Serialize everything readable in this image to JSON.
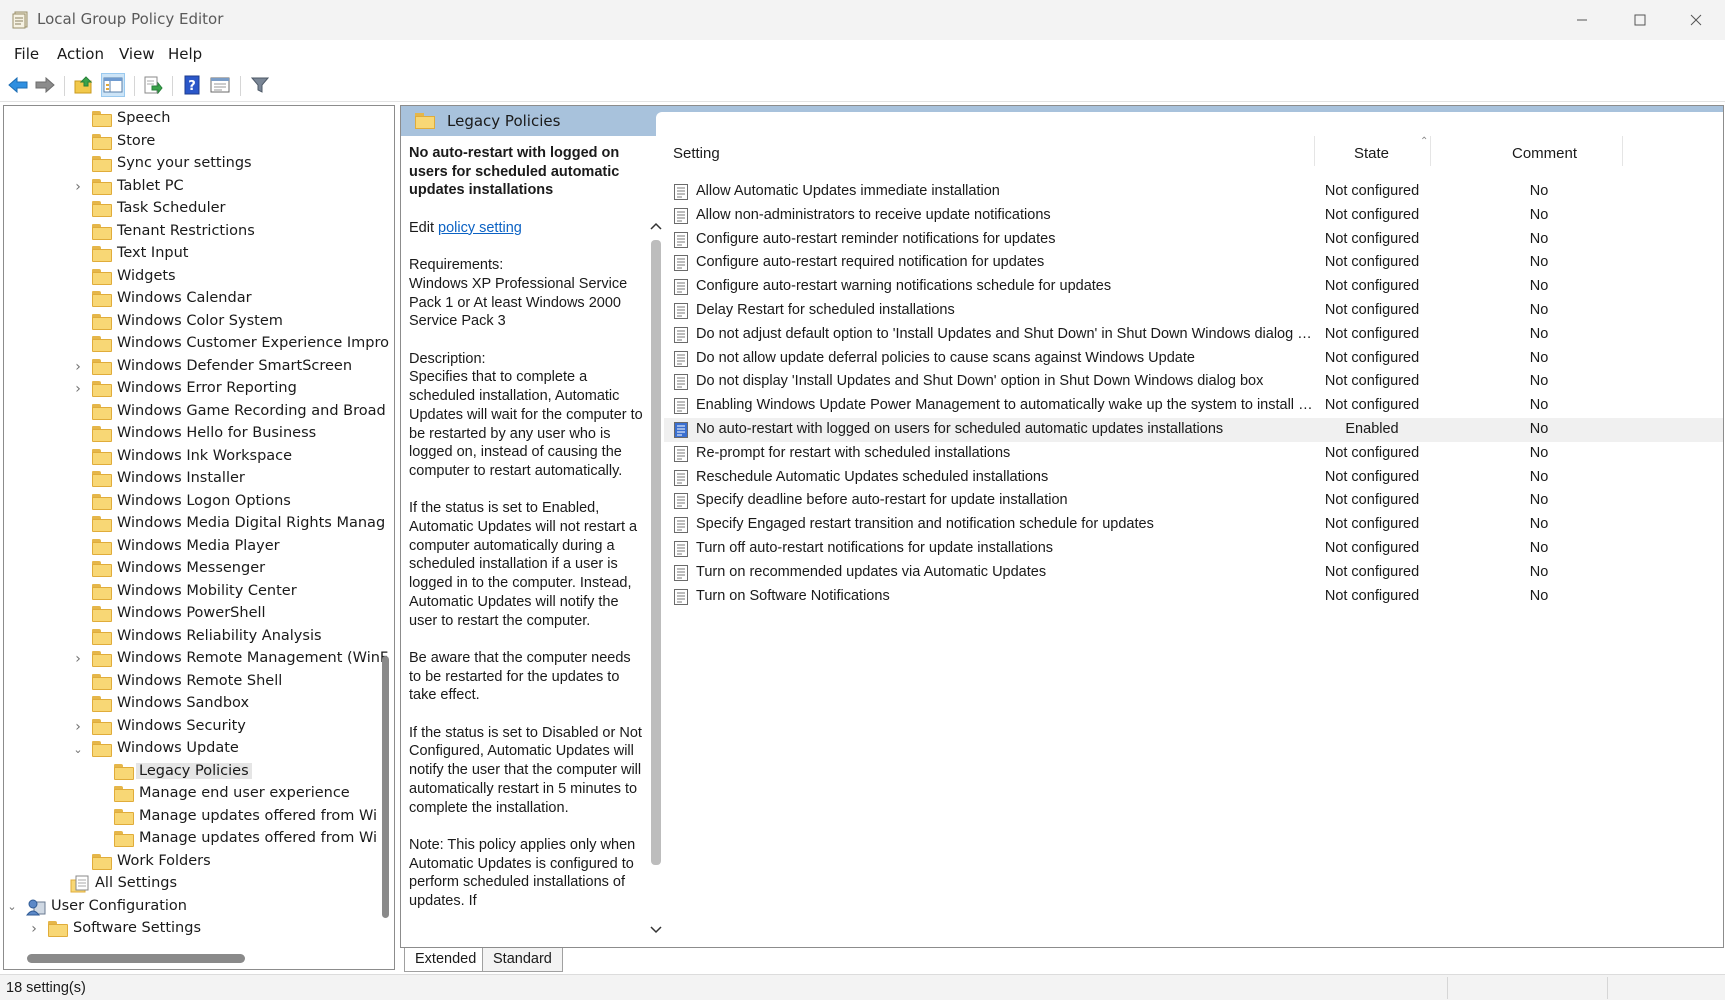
{
  "window": {
    "title": "Local Group Policy Editor"
  },
  "menu": [
    "File",
    "Action",
    "View",
    "Help"
  ],
  "toolbar": [
    "back-icon",
    "forward-icon",
    "up-folder-icon",
    "show-hide-tree-icon",
    "export-list-icon",
    "help-icon",
    "properties-icon",
    "filter-icon"
  ],
  "tree": [
    {
      "label": "Speech",
      "depth": 4,
      "exp": "none",
      "icon": "folder"
    },
    {
      "label": "Store",
      "depth": 4,
      "exp": "none",
      "icon": "folder"
    },
    {
      "label": "Sync your settings",
      "depth": 4,
      "exp": "none",
      "icon": "folder"
    },
    {
      "label": "Tablet PC",
      "depth": 4,
      "exp": "collapsed",
      "icon": "folder"
    },
    {
      "label": "Task Scheduler",
      "depth": 4,
      "exp": "none",
      "icon": "folder"
    },
    {
      "label": "Tenant Restrictions",
      "depth": 4,
      "exp": "none",
      "icon": "folder"
    },
    {
      "label": "Text Input",
      "depth": 4,
      "exp": "none",
      "icon": "folder"
    },
    {
      "label": "Widgets",
      "depth": 4,
      "exp": "none",
      "icon": "folder"
    },
    {
      "label": "Windows Calendar",
      "depth": 4,
      "exp": "none",
      "icon": "folder"
    },
    {
      "label": "Windows Color System",
      "depth": 4,
      "exp": "none",
      "icon": "folder"
    },
    {
      "label": "Windows Customer Experience Impro",
      "depth": 4,
      "exp": "none",
      "icon": "folder"
    },
    {
      "label": "Windows Defender SmartScreen",
      "depth": 4,
      "exp": "collapsed",
      "icon": "folder"
    },
    {
      "label": "Windows Error Reporting",
      "depth": 4,
      "exp": "collapsed",
      "icon": "folder"
    },
    {
      "label": "Windows Game Recording and Broad",
      "depth": 4,
      "exp": "none",
      "icon": "folder"
    },
    {
      "label": "Windows Hello for Business",
      "depth": 4,
      "exp": "none",
      "icon": "folder"
    },
    {
      "label": "Windows Ink Workspace",
      "depth": 4,
      "exp": "none",
      "icon": "folder"
    },
    {
      "label": "Windows Installer",
      "depth": 4,
      "exp": "none",
      "icon": "folder"
    },
    {
      "label": "Windows Logon Options",
      "depth": 4,
      "exp": "none",
      "icon": "folder"
    },
    {
      "label": "Windows Media Digital Rights Manag",
      "depth": 4,
      "exp": "none",
      "icon": "folder"
    },
    {
      "label": "Windows Media Player",
      "depth": 4,
      "exp": "none",
      "icon": "folder"
    },
    {
      "label": "Windows Messenger",
      "depth": 4,
      "exp": "none",
      "icon": "folder"
    },
    {
      "label": "Windows Mobility Center",
      "depth": 4,
      "exp": "none",
      "icon": "folder"
    },
    {
      "label": "Windows PowerShell",
      "depth": 4,
      "exp": "none",
      "icon": "folder"
    },
    {
      "label": "Windows Reliability Analysis",
      "depth": 4,
      "exp": "none",
      "icon": "folder"
    },
    {
      "label": "Windows Remote Management (WinF",
      "depth": 4,
      "exp": "collapsed",
      "icon": "folder"
    },
    {
      "label": "Windows Remote Shell",
      "depth": 4,
      "exp": "none",
      "icon": "folder"
    },
    {
      "label": "Windows Sandbox",
      "depth": 4,
      "exp": "none",
      "icon": "folder"
    },
    {
      "label": "Windows Security",
      "depth": 4,
      "exp": "collapsed",
      "icon": "folder"
    },
    {
      "label": "Windows Update",
      "depth": 4,
      "exp": "expanded",
      "icon": "folder"
    },
    {
      "label": "Legacy Policies",
      "depth": 5,
      "exp": "none",
      "icon": "folder",
      "selected": true
    },
    {
      "label": "Manage end user experience",
      "depth": 5,
      "exp": "none",
      "icon": "folder"
    },
    {
      "label": "Manage updates offered from Wi",
      "depth": 5,
      "exp": "none",
      "icon": "folder"
    },
    {
      "label": "Manage updates offered from Wi",
      "depth": 5,
      "exp": "none",
      "icon": "folder"
    },
    {
      "label": "Work Folders",
      "depth": 4,
      "exp": "none",
      "icon": "folder"
    },
    {
      "label": "All Settings",
      "depth": 3,
      "exp": "none",
      "icon": "settings"
    },
    {
      "label": "User Configuration",
      "depth": 1,
      "exp": "expanded",
      "icon": "user"
    },
    {
      "label": "Software Settings",
      "depth": 2,
      "exp": "collapsed",
      "icon": "folder"
    }
  ],
  "right_header": {
    "title": "Legacy Policies"
  },
  "description": {
    "title": "No auto-restart with logged on users for scheduled automatic updates installations",
    "edit_prefix": "Edit ",
    "edit_link": "policy setting ",
    "requirements": "Requirements:\nWindows XP Professional Service Pack 1 or At least Windows 2000 Service Pack 3",
    "description": "Description:\nSpecifies that to complete a scheduled installation, Automatic Updates will wait for the computer to be restarted by any user who is logged on, instead of causing the computer to restart automatically.",
    "enabled_text": "If the status is set to Enabled, Automatic Updates will not restart a computer automatically during a scheduled installation if a user is logged in to the computer. Instead, Automatic Updates will notify the user to restart the computer.",
    "aware_text": "Be aware that the computer needs to be restarted for the updates to take effect.",
    "disabled_text": "If the status is set to Disabled or Not Configured, Automatic Updates will notify the user that the computer will automatically restart in 5 minutes to complete the installation.",
    "note_text": "Note: This policy applies only when Automatic Updates is configured to perform scheduled installations of updates. If"
  },
  "list": {
    "columns": {
      "setting": "Setting",
      "state": "State",
      "comment": "Comment"
    },
    "rows": [
      {
        "name": "Allow Automatic Updates immediate installation",
        "state": "Not configured",
        "comment": "No"
      },
      {
        "name": "Allow non-administrators to receive update notifications",
        "state": "Not configured",
        "comment": "No"
      },
      {
        "name": "Configure auto-restart reminder notifications for updates",
        "state": "Not configured",
        "comment": "No"
      },
      {
        "name": "Configure auto-restart required notification for updates",
        "state": "Not configured",
        "comment": "No"
      },
      {
        "name": "Configure auto-restart warning notifications schedule for updates",
        "state": "Not configured",
        "comment": "No"
      },
      {
        "name": "Delay Restart for scheduled installations",
        "state": "Not configured",
        "comment": "No"
      },
      {
        "name": "Do not adjust default option to 'Install Updates and Shut Down' in Shut Down Windows dialog box",
        "state": "Not configured",
        "comment": "No"
      },
      {
        "name": "Do not allow update deferral policies to cause scans against Windows Update",
        "state": "Not configured",
        "comment": "No"
      },
      {
        "name": "Do not display 'Install Updates and Shut Down' option in Shut Down Windows dialog box",
        "state": "Not configured",
        "comment": "No"
      },
      {
        "name": "Enabling Windows Update Power Management to automatically wake up the system to install schedule...",
        "state": "Not configured",
        "comment": "No"
      },
      {
        "name": "No auto-restart with logged on users for scheduled automatic updates installations",
        "state": "Enabled",
        "comment": "No",
        "selected": true
      },
      {
        "name": "Re-prompt for restart with scheduled installations",
        "state": "Not configured",
        "comment": "No"
      },
      {
        "name": "Reschedule Automatic Updates scheduled installations",
        "state": "Not configured",
        "comment": "No"
      },
      {
        "name": "Specify deadline before auto-restart for update installation",
        "state": "Not configured",
        "comment": "No"
      },
      {
        "name": "Specify Engaged restart transition and notification schedule for updates",
        "state": "Not configured",
        "comment": "No"
      },
      {
        "name": "Turn off auto-restart notifications for update installations",
        "state": "Not configured",
        "comment": "No"
      },
      {
        "name": "Turn on recommended updates via Automatic Updates",
        "state": "Not configured",
        "comment": "No"
      },
      {
        "name": "Turn on Software Notifications",
        "state": "Not configured",
        "comment": "No"
      }
    ]
  },
  "tabs": [
    "Extended",
    "Standard"
  ],
  "status": {
    "text": "18 setting(s)"
  }
}
